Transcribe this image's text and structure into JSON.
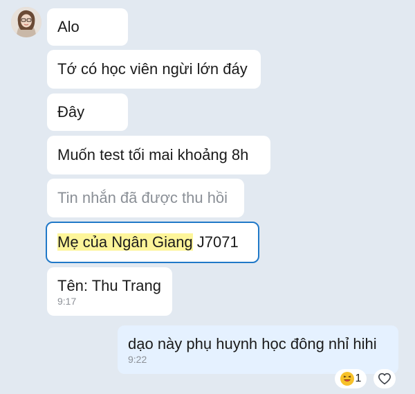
{
  "conversation": {
    "avatar_icon": "user-avatar",
    "messages": [
      {
        "text": "Alo",
        "type": "received"
      },
      {
        "text": "Tớ có học viên ngừi lớn đáy",
        "type": "received"
      },
      {
        "text": "Đây",
        "type": "received"
      },
      {
        "text": "Muốn test tối mai khoảng 8h",
        "type": "received"
      },
      {
        "text": "Tin nhắn đã được thu hồi",
        "type": "recalled"
      },
      {
        "highlight": "Mẹ của Ngân Giang",
        "rest": " J7071",
        "type": "quoted"
      },
      {
        "text": "Tên: Thu Trang",
        "time": "9:17",
        "type": "received"
      },
      {
        "text": "dạo này phụ huynh học đông nhỉ hihi",
        "time": "9:22",
        "type": "sent"
      }
    ],
    "reaction": {
      "emoji": "laughing-face-icon",
      "count": "1"
    },
    "heart_icon": "heart-icon",
    "colors": {
      "background": "#e2e9f1",
      "received_bubble": "#ffffff",
      "sent_bubble": "#e5f1ff",
      "quote_border": "#1f78c8",
      "highlight": "#fdf59a"
    }
  }
}
